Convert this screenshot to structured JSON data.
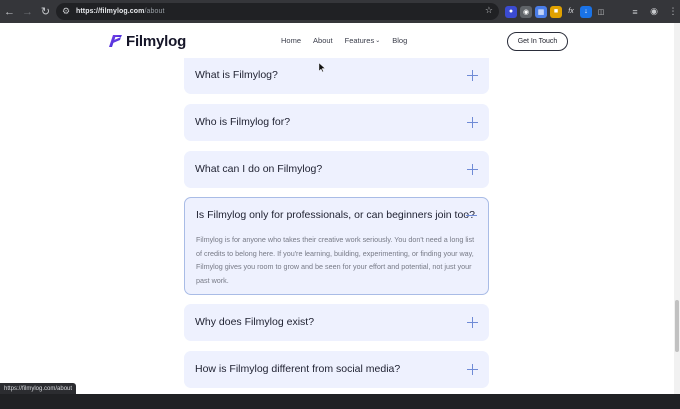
{
  "browser": {
    "url_host": "https://filmylog.com",
    "url_path": "/about",
    "status_url": "https://filmylog.com/about"
  },
  "header": {
    "logo_text": "Filmylog",
    "nav": [
      "Home",
      "About",
      "Features",
      "Blog"
    ],
    "cta_label": "Get In Touch"
  },
  "faq": [
    {
      "question": "What is Filmylog?",
      "state": "collapsed"
    },
    {
      "question": "Who is Filmylog for?",
      "state": "collapsed"
    },
    {
      "question": "What can I do on Filmylog?",
      "state": "collapsed"
    },
    {
      "question": "Is Filmylog only for professionals, or can beginners join too?",
      "state": "expanded",
      "answer": "Filmylog is for anyone who takes their creative work seriously. You don't need a long list of credits to belong here. If you're learning, building, experimenting, or finding your way, Filmylog gives you room to grow and be seen for your effort and potential, not just your past work."
    },
    {
      "question": "Why does Filmylog exist?",
      "state": "collapsed"
    },
    {
      "question": "How is Filmylog different from social media?",
      "state": "collapsed"
    }
  ],
  "colors": {
    "card_bg": "#eef1fe",
    "accent": "#6f8bd6",
    "logo_gradient": [
      "#7b3fe4",
      "#3b2bd9"
    ]
  }
}
